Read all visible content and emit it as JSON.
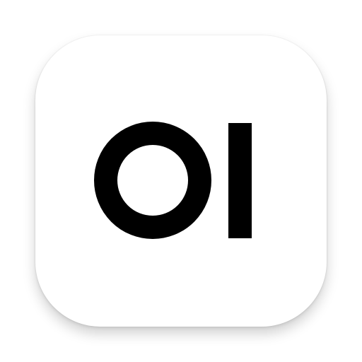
{
  "icon": {
    "logo_text": "OI",
    "background_color": "#ffffff",
    "glyph_color": "#000000"
  }
}
